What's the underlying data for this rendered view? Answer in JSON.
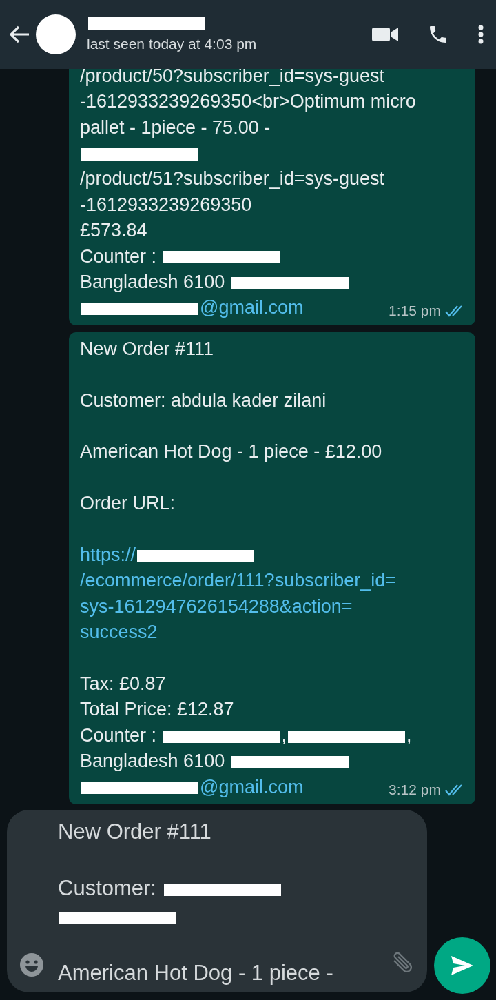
{
  "header": {
    "name": [
      {
        "kind": "redacted"
      }
    ],
    "status": "last seen today at 4:03 pm"
  },
  "messages": [
    {
      "paragraphs": [
        [
          [
            {
              "text": "/product/50?subscriber_id=sys-guest"
            }
          ],
          [
            {
              "text": "-1612933239269350<br>Optimum micro"
            }
          ],
          [
            {
              "text": "pallet - 1piece - 75.00 -"
            }
          ],
          [
            {
              "kind": "redacted"
            }
          ],
          [
            {
              "text": "/product/51?subscriber_id=sys-guest"
            }
          ],
          [
            {
              "text": "-1612933239269350"
            }
          ],
          [
            {
              "text": "£573.84"
            }
          ],
          [
            {
              "text": "Counter :  "
            },
            {
              "kind": "redacted"
            }
          ],
          [
            {
              "text": "Bangladesh 6100  "
            },
            {
              "kind": "redacted"
            }
          ],
          [
            {
              "kind": "redacted"
            },
            {
              "kind": "link",
              "text": "@gmail.com"
            }
          ]
        ]
      ],
      "time": "1:15 pm",
      "read": true
    },
    {
      "paragraphs": [
        [
          [
            {
              "text": "New Order #111"
            }
          ]
        ],
        [
          [
            {
              "text": "Customer: abdula kader zilani"
            }
          ]
        ],
        [
          [
            {
              "text": "American Hot Dog - 1 piece - £12.00"
            }
          ]
        ],
        [
          [
            {
              "text": "Order URL:"
            }
          ]
        ],
        [
          [
            {
              "kind": "link",
              "text": "https://"
            },
            {
              "kind": "redacted"
            }
          ],
          [
            {
              "kind": "link",
              "text": "/ecommerce/order/111?subscriber_id="
            }
          ],
          [
            {
              "kind": "link",
              "text": "sys-1612947626154288&action="
            }
          ],
          [
            {
              "kind": "link",
              "text": "success2"
            }
          ]
        ],
        [
          [
            {
              "text": "Tax: £0.87"
            }
          ],
          [
            {
              "text": "Total Price: £12.87"
            }
          ],
          [
            {
              "text": "Counter :  "
            },
            {
              "kind": "redacted"
            },
            {
              "text": ","
            },
            {
              "kind": "redacted"
            },
            {
              "text": ","
            }
          ],
          [
            {
              "text": "Bangladesh 6100  "
            },
            {
              "kind": "redacted"
            }
          ],
          [
            {
              "kind": "redacted"
            },
            {
              "kind": "link",
              "text": "@gmail.com"
            }
          ]
        ]
      ],
      "time": "3:12 pm",
      "read": true
    }
  ],
  "composer": {
    "paragraphs": [
      [
        [
          {
            "text": "New Order #111"
          }
        ]
      ],
      [
        [
          {
            "text": "Customer: "
          },
          {
            "kind": "redacted"
          }
        ],
        [
          {
            "kind": "redacted"
          }
        ]
      ],
      [
        [
          {
            "text": "American Hot Dog - 1 piece -"
          }
        ]
      ]
    ]
  }
}
